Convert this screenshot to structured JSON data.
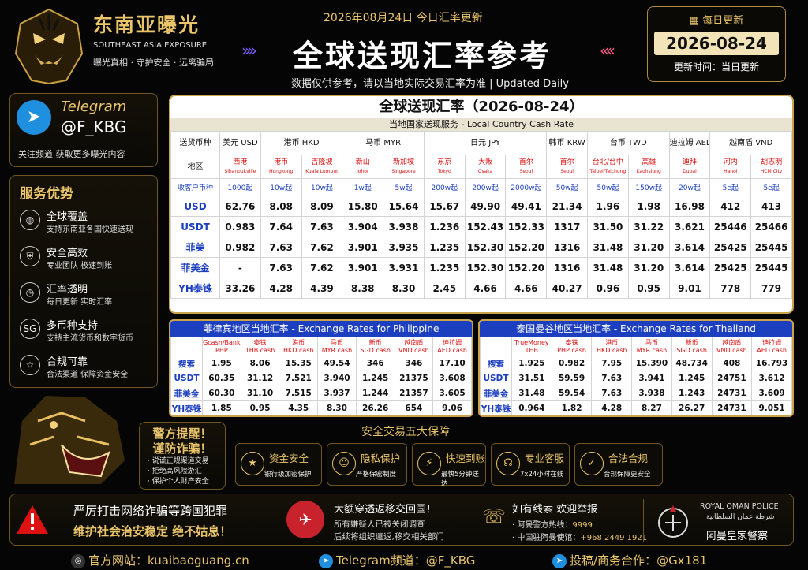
{
  "brand": {
    "cn": "东南亚曝光",
    "en": "SOUTHEAST ASIA EXPOSURE",
    "slogan": "曝光真相 · 守护安全 · 远离骗局"
  },
  "header": {
    "date_line": "2026年08月24日 今日汇率更新",
    "title": "全球送现汇率参考",
    "subtitle": "数据仅供参考，请以当地实际交易汇率为准 | Updated Daily"
  },
  "daily": {
    "title": "每日更新",
    "date": "2026-08-24",
    "update": "更新时间：当日更新"
  },
  "telegram": {
    "label": "Telegram",
    "handle": "@F_KBG",
    "note": "关注频道  获取更多曝光内容"
  },
  "services": {
    "title": "服务优势",
    "items": [
      {
        "icon": "globe-icon",
        "title": "全球覆盖",
        "desc": "支持东南亚各国快速送现"
      },
      {
        "icon": "shield-icon",
        "title": "安全高效",
        "desc": "专业团队 极速到账"
      },
      {
        "icon": "clock-icon",
        "title": "汇率透明",
        "desc": "每日更新 实时汇率"
      },
      {
        "icon": "currency-icon",
        "title": "多币种支持",
        "desc": "支持主流货币和数字货币"
      },
      {
        "icon": "star-icon",
        "title": "合规可靠",
        "desc": "合法渠道 保障资金安全"
      }
    ]
  },
  "police_alert": {
    "l1": "警方提醒！",
    "l2": "谨防诈骗！",
    "tips": [
      "· 说谎正规渠道交易",
      "· 拒绝高风险游汇",
      "· 保护个人财产安全"
    ]
  },
  "main_table": {
    "title": "全球送现汇率（2026-08-24）",
    "subtitle": "当地国家送现服务 - Local Country Cash Rate",
    "label_currency": "送货币种",
    "label_area": "地区",
    "label_min": "收客户币种",
    "currencies": [
      {
        "name": "美元 USD",
        "span": 1
      },
      {
        "name": "港币 HKD",
        "span": 2
      },
      {
        "name": "马币 MYR",
        "span": 2
      },
      {
        "name": "日元 JPY",
        "span": 3
      },
      {
        "name": "韩币 KRW",
        "span": 1
      },
      {
        "name": "台币 TWD",
        "span": 2
      },
      {
        "name": "迪拉姆 AED",
        "span": 1
      },
      {
        "name": "越南盾 VND",
        "span": 2
      }
    ],
    "cities": [
      {
        "cn": "西港",
        "en": "Sihanoukville"
      },
      {
        "cn": "港币",
        "en": "Hongkong"
      },
      {
        "cn": "吉隆坡",
        "en": "Kuala Lumpur"
      },
      {
        "cn": "新山",
        "en": "Johor"
      },
      {
        "cn": "新加坡",
        "en": "Singapore"
      },
      {
        "cn": "东京",
        "en": "Tokyo"
      },
      {
        "cn": "大阪",
        "en": "Osaka"
      },
      {
        "cn": "首尔",
        "en": "Seoul"
      },
      {
        "cn": "首尔",
        "en": "Seoul"
      },
      {
        "cn": "台北/台中",
        "en": "Taipei/Taichung"
      },
      {
        "cn": "高雄",
        "en": "Kaohsiung"
      },
      {
        "cn": "迪拜",
        "en": "Dubai"
      },
      {
        "cn": "河内",
        "en": "Hanoi"
      },
      {
        "cn": "胡志明",
        "en": "HCM City"
      }
    ],
    "minimums": [
      "1000起",
      "10w起",
      "10w起",
      "1w起",
      "5w起",
      "200w起",
      "200w起",
      "2000w起",
      "50w起",
      "50w起",
      "150w起",
      "20w起",
      "5e起",
      "5e起"
    ],
    "rows": [
      {
        "label": "USD",
        "values": [
          "62.76",
          "8.08",
          "8.09",
          "15.80",
          "15.64",
          "15.67",
          "49.90",
          "49.41",
          "21.34",
          "1.96",
          "1.98",
          "16.98",
          "412",
          "413"
        ]
      },
      {
        "label": "USDT",
        "values": [
          "0.983",
          "7.64",
          "7.63",
          "3.904",
          "3.938",
          "1.236",
          "152.43",
          "152.33",
          "1317",
          "31.50",
          "31.22",
          "3.621",
          "25446",
          "25466"
        ]
      },
      {
        "label": "菲美",
        "values": [
          "0.982",
          "7.63",
          "7.62",
          "3.901",
          "3.935",
          "1.235",
          "152.30",
          "152.20",
          "1316",
          "31.48",
          "31.20",
          "3.614",
          "25425",
          "25445"
        ]
      },
      {
        "label": "菲美金",
        "values": [
          "-",
          "7.63",
          "7.62",
          "3.901",
          "3.931",
          "1.235",
          "152.30",
          "152.20",
          "1316",
          "31.48",
          "31.20",
          "3.614",
          "25425",
          "25445"
        ]
      },
      {
        "label": "YH泰铢",
        "values": [
          "33.26",
          "4.28",
          "4.39",
          "8.38",
          "8.30",
          "2.45",
          "4.66",
          "4.66",
          "40.27",
          "0.96",
          "0.95",
          "9.01",
          "778",
          "779"
        ]
      }
    ]
  },
  "ph_table": {
    "title": "菲律宾地区当地汇率 - Exchange Rates for Philippine",
    "headers": [
      [
        "Gcash/Bank",
        "PHP"
      ],
      [
        "泰铢",
        "THB cash"
      ],
      [
        "港币",
        "HKD cash"
      ],
      [
        "马币",
        "MYR cash"
      ],
      [
        "新币",
        "SGD cash"
      ],
      [
        "越南盾",
        "VND cash"
      ],
      [
        "迪拉姆",
        "AED cash"
      ]
    ],
    "rows": [
      {
        "label": "搜索",
        "values": [
          "1.95",
          "8.06",
          "15.35",
          "49.54",
          "346",
          "346",
          "17.10"
        ]
      },
      {
        "label": "USDT",
        "values": [
          "60.35",
          "31.12",
          "7.521",
          "3.940",
          "1.245",
          "21375",
          "3.608"
        ]
      },
      {
        "label": "菲美金",
        "values": [
          "60.30",
          "31.10",
          "7.515",
          "3.937",
          "1.244",
          "21357",
          "3.605"
        ]
      },
      {
        "label": "YH泰铢",
        "values": [
          "1.85",
          "0.95",
          "4.35",
          "8.30",
          "26.26",
          "654",
          "9.06"
        ]
      }
    ]
  },
  "th_table": {
    "title": "泰国曼谷地区当地汇率 - Exchange Rates for Thailand",
    "headers": [
      [
        "TrueMoney",
        "THB"
      ],
      [
        "泰铢",
        "PHP cash"
      ],
      [
        "港币",
        "HKD cash"
      ],
      [
        "马币",
        "MYR cash"
      ],
      [
        "新币",
        "SGD cash"
      ],
      [
        "越南盾",
        "VND cash"
      ],
      [
        "迪拉姆",
        "AED cash"
      ]
    ],
    "rows": [
      {
        "label": "搜索",
        "values": [
          "1.925",
          "0.982",
          "7.95",
          "15.390",
          "48.734",
          "408",
          "16.793"
        ]
      },
      {
        "label": "USDT",
        "values": [
          "31.51",
          "59.59",
          "7.63",
          "3.941",
          "1.245",
          "24751",
          "3.612"
        ]
      },
      {
        "label": "菲美金",
        "values": [
          "31.48",
          "59.54",
          "7.63",
          "3.938",
          "1.243",
          "24731",
          "3.609"
        ]
      },
      {
        "label": "YH泰铢",
        "values": [
          "0.964",
          "1.82",
          "4.28",
          "8.27",
          "26.27",
          "24731",
          "9.051"
        ]
      }
    ]
  },
  "guarantees": {
    "title": "安全交易五大保障",
    "items": [
      {
        "icon": "shield-star-icon",
        "title": "资金安全",
        "desc": "银行级加密保护"
      },
      {
        "icon": "user-lock-icon",
        "title": "隐私保护",
        "desc": "严格保密制度"
      },
      {
        "icon": "lightning-icon",
        "title": "快速到账",
        "desc": "最快5分钟送达"
      },
      {
        "icon": "headset-icon",
        "title": "专业客服",
        "desc": "7x24小时在线"
      },
      {
        "icon": "check-circle-icon",
        "title": "合法合规",
        "desc": "合规保障更安全"
      }
    ]
  },
  "banner": {
    "m1": "严厉打击网络诈骗等跨国犯罪",
    "m2": "维护社会治安稳定  绝不姑息！",
    "p1": "大额穿透返移交回国！",
    "p2": "所有嫌疑人已被关闭调查",
    "p3": "后续将组织遣返,移交相关部门",
    "c1": "如有线索   欢迎举报",
    "c2_label": "· 阿曼警方热线：",
    "c2_value": "9999",
    "c3_label": "· 中国驻阿曼使馆：",
    "c3_value": "+968 2449 1921",
    "r1": "ROYAL OMAN POLICE",
    "r2": "شرطة عمان السلطانية",
    "r3": "阿曼皇家警察"
  },
  "footer": {
    "site_label": "官方网站：",
    "site": "kuaibaoguang.cn",
    "tg_label": "Telegram频道：",
    "tg": "@F_KBG",
    "contact_label": "投稿/商务合作：",
    "contact": "@Gx181"
  },
  "colors": {
    "gold": "#e9c46a",
    "blue": "#1c3fbf",
    "red": "#d11111"
  }
}
